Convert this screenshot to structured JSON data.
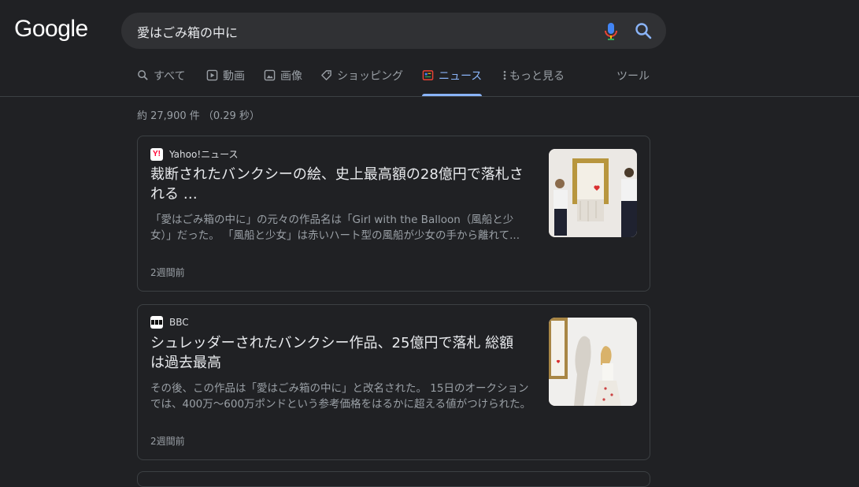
{
  "logo": "Google",
  "search": {
    "query": "愛はごみ箱の中に"
  },
  "tabs": [
    {
      "label": "すべて",
      "icon": "search-icon"
    },
    {
      "label": "動画",
      "icon": "video-icon"
    },
    {
      "label": "画像",
      "icon": "image-icon"
    },
    {
      "label": "ショッピング",
      "icon": "tag-icon"
    },
    {
      "label": "ニュース",
      "icon": "news-icon",
      "active": true
    },
    {
      "label": "もっと見る",
      "icon": "more-vert-icon"
    }
  ],
  "tools_label": "ツール",
  "stats": "約 27,900 件 （0.29 秒）",
  "results": [
    {
      "source": "Yahoo!ニュース",
      "favicon": "yahoo-japan-icon",
      "title": "裁断されたバンクシーの絵、史上最高額の28億円で落札される …",
      "snippet": "「愛はごみ箱の中に」の元々の作品名は「Girl with the Balloon（風船と少女）」だった。 「風船と少女」は赤いハート型の風船が少女の手から離れて...",
      "date": "2週間前"
    },
    {
      "source": "BBC",
      "favicon": "bbc-icon",
      "title": "シュレッダーされたバンクシー作品、25億円で落札 総額は過去最高",
      "snippet": "その後、この作品は「愛はごみ箱の中に」と改名された。 15日のオークションでは、400万～600万ポンドという参考価格をはるかに超える値がつけられた。",
      "date": "2週間前"
    }
  ],
  "colors": {
    "background": "#202124",
    "accent": "#8ab4f8",
    "border": "#3c4043"
  }
}
